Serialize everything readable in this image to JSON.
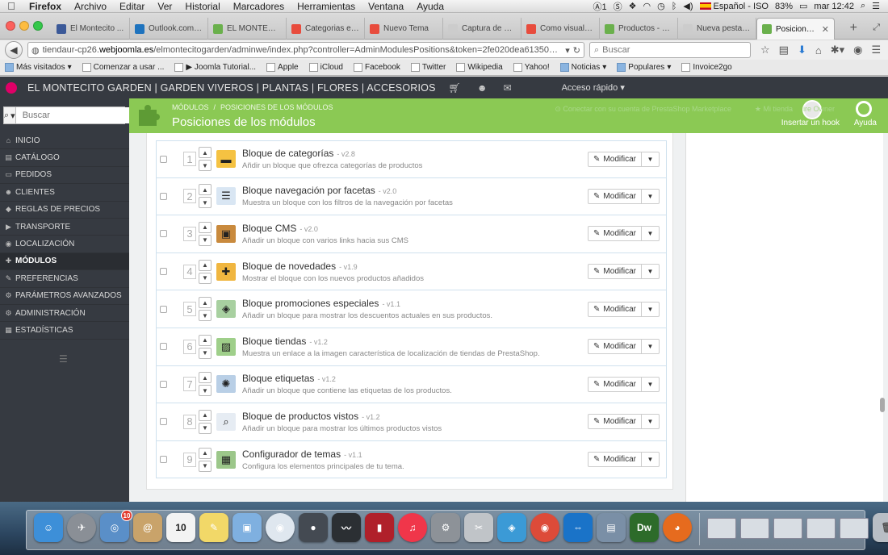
{
  "menubar": {
    "app": "Firefox",
    "items": [
      "Archivo",
      "Editar",
      "Ver",
      "Historial",
      "Marcadores",
      "Herramientas",
      "Ventana",
      "Ayuda"
    ],
    "badge": "1",
    "input_source": "Español - ISO",
    "battery": "83%",
    "time": "mar 12:42"
  },
  "tabs": [
    {
      "label": "El Montecito ...",
      "color": "#3b5998"
    },
    {
      "label": "Outlook.com ...",
      "color": "#1e73be"
    },
    {
      "label": "EL MONTECIT...",
      "color": "#6ab04c"
    },
    {
      "label": "Categorias en...",
      "color": "#e84c3d"
    },
    {
      "label": "Nuevo Tema",
      "color": "#e84c3d"
    },
    {
      "label": "Captura de Pantall...",
      "color": "#cccccc"
    },
    {
      "label": "Como visualiz...",
      "color": "#e84c3d"
    },
    {
      "label": "Productos - 4...",
      "color": "#6ab04c"
    },
    {
      "label": "Nueva pestaña",
      "color": "#cccccc"
    },
    {
      "label": "Posiciones...",
      "color": "#6ab04c"
    }
  ],
  "nav": {
    "url_prefix": "tiendaur-cp26.",
    "url_domain": "webjoomla.es",
    "url_rest": "/elmontecitogarden/adminwe/index.php?controller=AdminModulesPositions&token=2fe020dea613508f6e2f",
    "search_placeholder": "Buscar"
  },
  "bookmarks": [
    {
      "label": "Más visitados",
      "folder": true,
      "dropdown": true
    },
    {
      "label": "Comenzar a usar ...",
      "folder": false
    },
    {
      "label": "▶ Joomla Tutorial...",
      "folder": false
    },
    {
      "label": "Apple",
      "folder": false
    },
    {
      "label": "iCloud",
      "folder": false
    },
    {
      "label": "Facebook",
      "folder": false
    },
    {
      "label": "Twitter",
      "folder": false
    },
    {
      "label": "Wikipedia",
      "folder": false
    },
    {
      "label": "Yahoo!",
      "folder": false
    },
    {
      "label": "Noticias",
      "folder": true,
      "dropdown": true
    },
    {
      "label": "Populares",
      "folder": true,
      "dropdown": true
    },
    {
      "label": "Invoice2go",
      "folder": false
    }
  ],
  "header": {
    "shop_name": "EL MONTECITO GARDEN | GARDEN VIVEROS | PLANTAS | FLORES | ACCESORIOS",
    "quick_access": "Acceso rápido ▾"
  },
  "sidebar": {
    "search_placeholder": "Buscar",
    "items": [
      {
        "label": "INICIO",
        "icon": "⌂",
        "active": false
      },
      {
        "label": "CATÁLOGO",
        "icon": "▤",
        "active": false
      },
      {
        "label": "PEDIDOS",
        "icon": "▭",
        "active": false
      },
      {
        "label": "CLIENTES",
        "icon": "☻",
        "active": false
      },
      {
        "label": "REGLAS DE PRECIOS",
        "icon": "◆",
        "active": false
      },
      {
        "label": "TRANSPORTE",
        "icon": "▶",
        "active": false
      },
      {
        "label": "LOCALIZACIÓN",
        "icon": "◉",
        "active": false
      },
      {
        "label": "MÓDULOS",
        "icon": "✚",
        "active": true
      },
      {
        "label": "PREFERENCIAS",
        "icon": "✎",
        "active": false
      },
      {
        "label": "PARÁMETROS AVANZADOS",
        "icon": "⚙",
        "active": false
      },
      {
        "label": "ADMINISTRACIÓN",
        "icon": "⚙",
        "active": false
      },
      {
        "label": "ESTADÍSTICAS",
        "icon": "▦",
        "active": false
      }
    ]
  },
  "page": {
    "breadcrumb_1": "MÓDULOS",
    "breadcrumb_2": "POSICIONES DE LOS MÓDULOS",
    "title": "Posiciones de los módulos",
    "connect": "Conectar con su cuenta de PrestaShop Marketplace",
    "my_shop": "Mi tienda",
    "owner": "ire Owner",
    "hook_btn": "Insertar un hook",
    "help_btn": "Ayuda"
  },
  "modules": [
    {
      "pos": "1",
      "name": "Bloque de categorías",
      "version": "- v2.8",
      "desc": "Añdir un bloque que ofrezca categorías de productos",
      "icon_color": "#f5c242",
      "glyph": "▬"
    },
    {
      "pos": "2",
      "name": "Bloque navegación por facetas",
      "version": "- v2.0",
      "desc": "Muestra un bloque con los filtros de la navegación por facetas",
      "icon_color": "#d9e6f3",
      "glyph": "☰"
    },
    {
      "pos": "3",
      "name": "Bloque CMS",
      "version": "- v2.0",
      "desc": "Añadir un bloque con varios links hacia sus CMS",
      "icon_color": "#c98a3d",
      "glyph": "▣"
    },
    {
      "pos": "4",
      "name": "Bloque de novedades",
      "version": "- v1.9",
      "desc": "Mostrar el bloque con los nuevos productos añadidos",
      "icon_color": "#f0b640",
      "glyph": "✚"
    },
    {
      "pos": "5",
      "name": "Bloque promociones especiales",
      "version": "- v1.1",
      "desc": "Añadir un bloque para mostrar los descuentos actuales en sus productos.",
      "icon_color": "#a8d0a0",
      "glyph": "◈"
    },
    {
      "pos": "6",
      "name": "Bloque tiendas",
      "version": "- v1.2",
      "desc": "Muestra un enlace a la imagen característica de localización de tiendas de PrestaShop.",
      "icon_color": "#9fcf8a",
      "glyph": "▨"
    },
    {
      "pos": "7",
      "name": "Bloque etiquetas",
      "version": "- v1.2",
      "desc": "Añadir un bloque que contiene las etiquetas de los productos.",
      "icon_color": "#b9cfe6",
      "glyph": "✺"
    },
    {
      "pos": "8",
      "name": "Bloque de productos vistos",
      "version": "- v1.2",
      "desc": "Añadir un bloque para mostrar los últimos productos vistos",
      "icon_color": "#e6ecf3",
      "glyph": "⌕"
    },
    {
      "pos": "9",
      "name": "Configurador de temas",
      "version": "- v1.1",
      "desc": "Configura los elementos principales de tu tema.",
      "icon_color": "#9cc78a",
      "glyph": "▦"
    }
  ],
  "modify_label": "Modificar",
  "dock": [
    {
      "name": "Finder",
      "color": "#3d8fd8",
      "glyph": "☺",
      "round": false,
      "badge": ""
    },
    {
      "name": "Launchpad",
      "color": "#8a8f96",
      "glyph": "✈",
      "round": true,
      "badge": ""
    },
    {
      "name": "Photo",
      "color": "#5a8fc8",
      "glyph": "◎",
      "round": false,
      "badge": "10"
    },
    {
      "name": "Contacts",
      "color": "#c9a36a",
      "glyph": "@",
      "round": false,
      "badge": ""
    },
    {
      "name": "Calendar",
      "color": "#f3f3f3",
      "glyph": "10",
      "round": false,
      "badge": ""
    },
    {
      "name": "Notes",
      "color": "#f2d868",
      "glyph": "✎",
      "round": false,
      "badge": ""
    },
    {
      "name": "Preview",
      "color": "#7fb0e0",
      "glyph": "▣",
      "round": false,
      "badge": ""
    },
    {
      "name": "Safari",
      "color": "#dfe7ef",
      "glyph": "◉",
      "round": true,
      "badge": ""
    },
    {
      "name": "Camera",
      "color": "#444a52",
      "glyph": "●",
      "round": false,
      "badge": ""
    },
    {
      "name": "Activity",
      "color": "#2b2f33",
      "glyph": "〰",
      "round": false,
      "badge": ""
    },
    {
      "name": "PhotoBooth",
      "color": "#b0202a",
      "glyph": "▮",
      "round": false,
      "badge": ""
    },
    {
      "name": "Music",
      "color": "#f0364a",
      "glyph": "♫",
      "round": true,
      "badge": ""
    },
    {
      "name": "Settings",
      "color": "#8d9298",
      "glyph": "⚙",
      "round": false,
      "badge": ""
    },
    {
      "name": "Scissors",
      "color": "#c0c4c8",
      "glyph": "✂",
      "round": false,
      "badge": ""
    },
    {
      "name": "Network",
      "color": "#3b9ad6",
      "glyph": "◈",
      "round": false,
      "badge": ""
    },
    {
      "name": "Chrome",
      "color": "#dd4b39",
      "glyph": "◉",
      "round": true,
      "badge": ""
    },
    {
      "name": "TeamViewer",
      "color": "#1a73c8",
      "glyph": "⇔",
      "round": false,
      "badge": ""
    },
    {
      "name": "Photos",
      "color": "#7a8fa6",
      "glyph": "▤",
      "round": false,
      "badge": ""
    },
    {
      "name": "Dreamweaver",
      "color": "#2d6b2a",
      "glyph": "Dw",
      "round": false,
      "badge": ""
    },
    {
      "name": "Firefox",
      "color": "#e66b1e",
      "glyph": "◕",
      "round": true,
      "badge": ""
    }
  ]
}
